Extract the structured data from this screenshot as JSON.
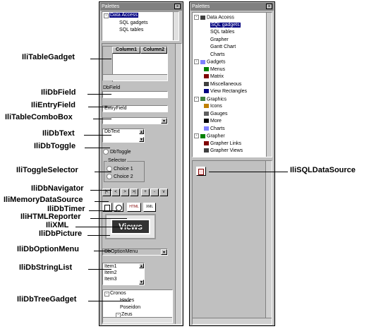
{
  "left_palette": {
    "title": "Palettes",
    "close": "×",
    "tree": [
      "Data Access",
      "SQL gadgets",
      "SQL tables"
    ],
    "table_headers": [
      "Column1",
      "Column2"
    ],
    "dbfield_label": "DbField",
    "entry_value": "EntryField",
    "dbtext_value": "DbText",
    "toggle_label": "DbToggle",
    "selector_label": "Selector",
    "choices": [
      "Choice 1",
      "Choice 2"
    ],
    "nav_buttons": [
      "|<",
      "<",
      ">",
      ">|",
      "+",
      "-",
      "v"
    ],
    "views_label": "Views",
    "option_menu_value": "DbOptionMenu",
    "string_list": [
      "Item1",
      "Item2",
      "Item3"
    ],
    "tree_gadget": [
      "Cronos",
      "Hades",
      "Poseidon",
      "Zeus"
    ]
  },
  "right_palette": {
    "title": "Palettes",
    "close": "×",
    "tree": [
      {
        "label": "Data Access",
        "level": 0,
        "icon": "minus-box"
      },
      {
        "label": "SQL gadgets",
        "level": 1,
        "selected": true
      },
      {
        "label": "SQL tables",
        "level": 1
      },
      {
        "label": "Grapher",
        "level": 1
      },
      {
        "label": "Gantt Chart",
        "level": 1
      },
      {
        "label": "Charts",
        "level": 1
      },
      {
        "label": "Gadgets",
        "level": 0,
        "icon": "minus-box"
      },
      {
        "label": "Menus",
        "level": 1
      },
      {
        "label": "Matrix",
        "level": 1
      },
      {
        "label": "Miscellaneous",
        "level": 1
      },
      {
        "label": "View Rectangles",
        "level": 1
      },
      {
        "label": "Graphics",
        "level": 0,
        "icon": "minus-box"
      },
      {
        "label": "Icons",
        "level": 1
      },
      {
        "label": "Gauges",
        "level": 1
      },
      {
        "label": "More",
        "level": 1
      },
      {
        "label": "Charts",
        "level": 1
      },
      {
        "label": "Grapher",
        "level": 0,
        "icon": "minus-box"
      },
      {
        "label": "Grapher Links",
        "level": 1
      },
      {
        "label": "Grapher Views",
        "level": 1
      }
    ]
  },
  "callouts": {
    "IliTableGadget": "IliTableGadget",
    "IliDbField": "IliDbField",
    "IliEntryField": "IliEntryField",
    "IliTableComboBox": "IliTableComboBox",
    "IliDbText": "IliDbText",
    "IliDbToggle": "IliDbToggle",
    "IliToggleSelector": "IliToggleSelector",
    "IliDbNavigator": "IliDbNavigator",
    "IliMemoryDataSource": "IliMemoryDataSource",
    "IliDbTimer": "IliDbTimer",
    "IliHTMLReporter": "IliHTMLReporter",
    "IliXML": "IliXML",
    "IliDbPicture": "IliDbPicture",
    "IliDbOptionMenu": "IliDbOptionMenu",
    "IliDbStringList": "IliDbStringList",
    "IliDbTreeGadget": "IliDbTreeGadget",
    "IliSQLDataSource": "IliSQLDataSource"
  }
}
